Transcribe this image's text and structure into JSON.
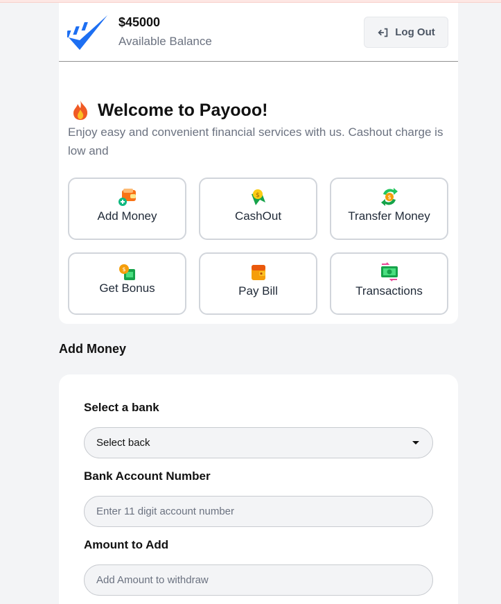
{
  "header": {
    "balance": "$45000",
    "balance_label": "Available Balance",
    "logout_label": "Log Out"
  },
  "welcome": {
    "title": "Welcome to Payooo!",
    "description": "Enjoy easy and convenient financial services with us. Cashout charge is low and"
  },
  "services": [
    {
      "label": "Add Money",
      "icon": "wallet-add-icon"
    },
    {
      "label": "CashOut",
      "icon": "cashout-icon"
    },
    {
      "label": "Transfer Money",
      "icon": "transfer-icon"
    },
    {
      "label": "Get Bonus",
      "icon": "bonus-icon"
    },
    {
      "label": "Pay Bill",
      "icon": "pay-bill-icon"
    },
    {
      "label": "Transactions",
      "icon": "transactions-icon"
    }
  ],
  "form": {
    "title": "Add Money",
    "bank_label": "Select a bank",
    "bank_selected": "Select back",
    "account_label": "Bank Account Number",
    "account_placeholder": "Enter 11 digit account number",
    "amount_label": "Amount to Add",
    "amount_placeholder": "Add Amount to withdraw"
  },
  "colors": {
    "brand": "#1d6ff2",
    "page_bg": "#f3f4f6",
    "card_border": "#d1d5db"
  }
}
